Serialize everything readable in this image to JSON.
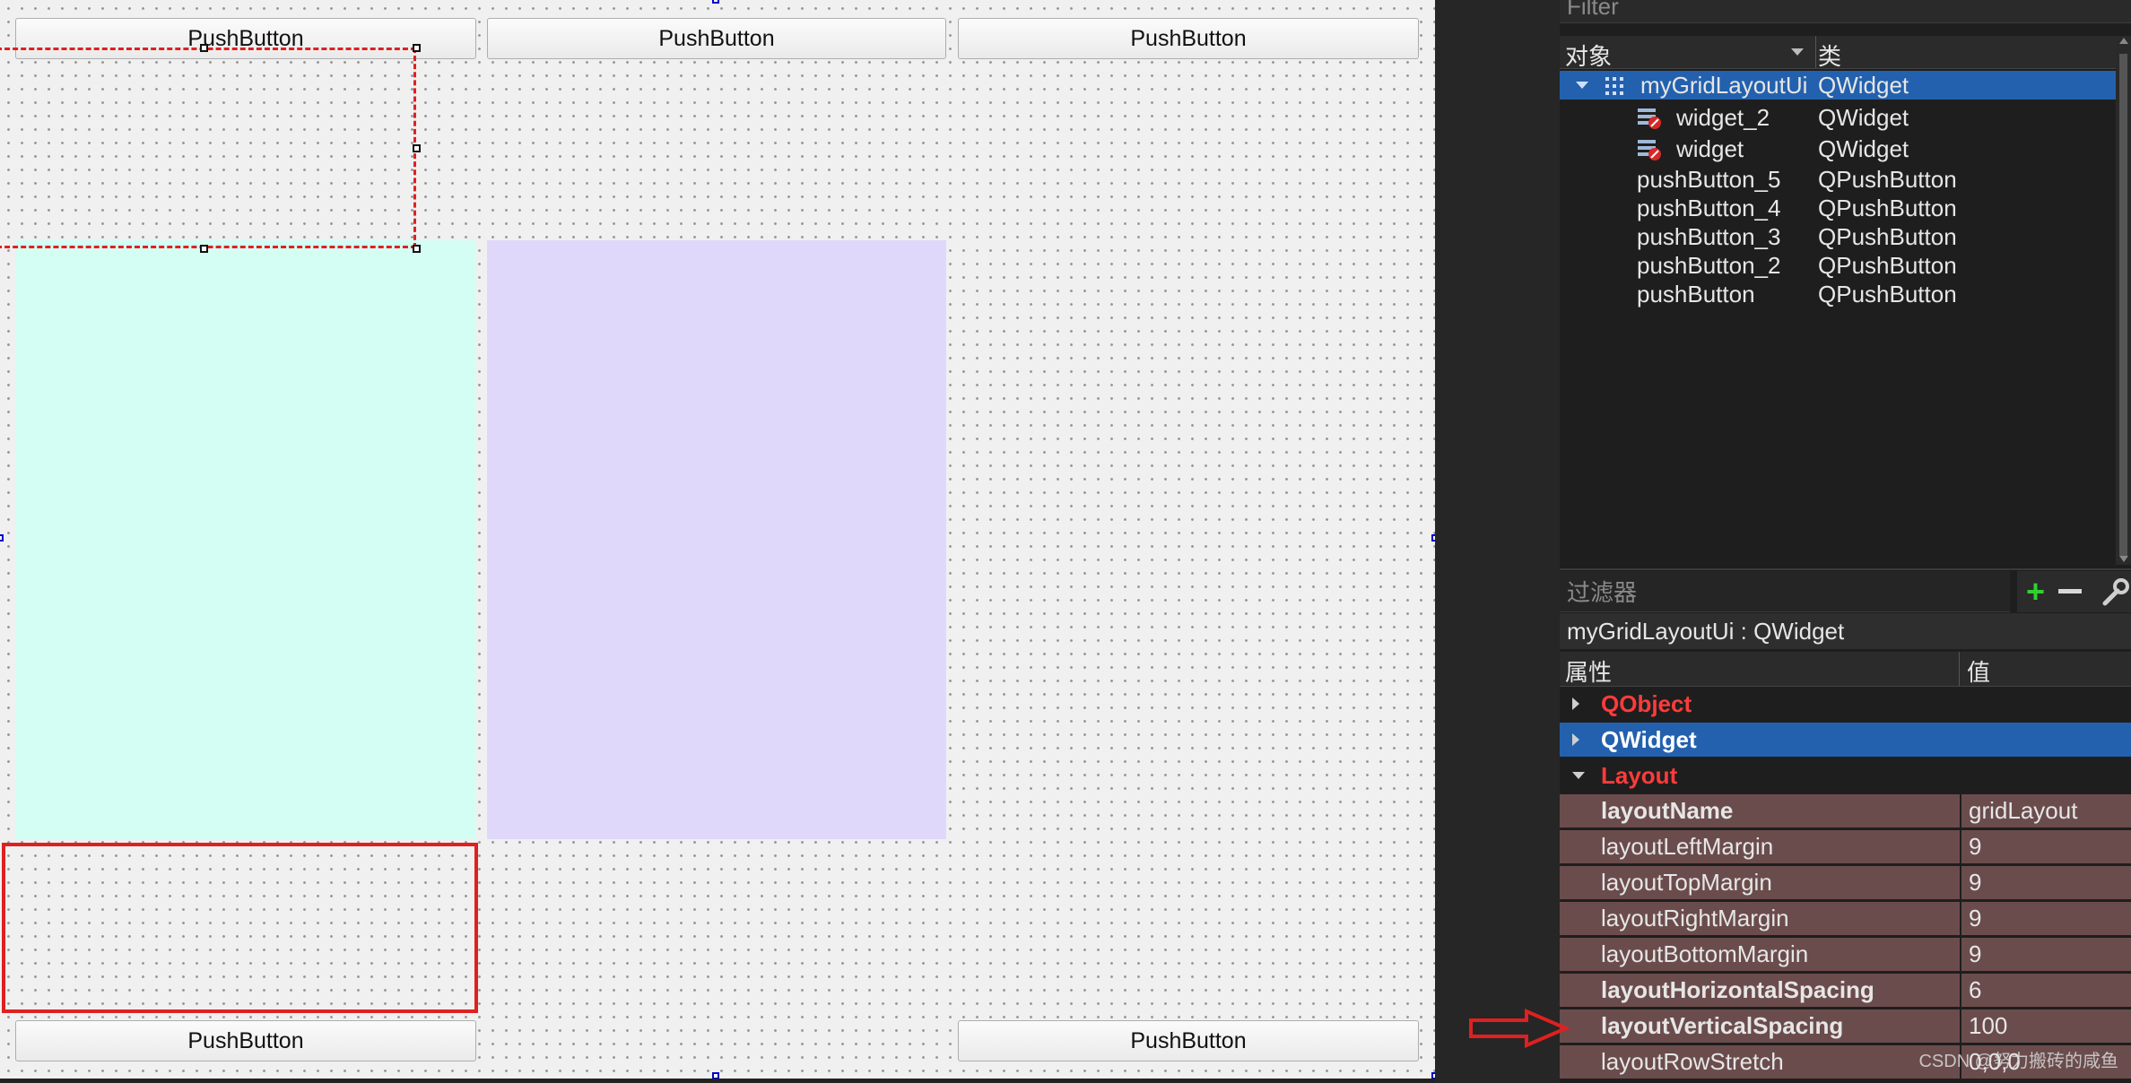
{
  "canvas": {
    "buttons": {
      "top_left": "PushButton",
      "top_middle": "PushButton",
      "top_right": "PushButton",
      "bottom_left": "PushButton",
      "bottom_right": "PushButton"
    },
    "colors": {
      "widget_2": "#d4fdf4",
      "widget": "#e0d8fb",
      "selection": "#e02020"
    }
  },
  "object_inspector": {
    "filter_placeholder": "Filter",
    "col_object": "对象",
    "col_class": "类",
    "objects": [
      {
        "name": "myGridLayoutUi",
        "class": "QWidget"
      },
      {
        "name": "widget_2",
        "class": "QWidget"
      },
      {
        "name": "widget",
        "class": "QWidget"
      },
      {
        "name": "pushButton_5",
        "class": "QPushButton"
      },
      {
        "name": "pushButton_4",
        "class": "QPushButton"
      },
      {
        "name": "pushButton_3",
        "class": "QPushButton"
      },
      {
        "name": "pushButton_2",
        "class": "QPushButton"
      },
      {
        "name": "pushButton",
        "class": "QPushButton"
      }
    ]
  },
  "property_editor": {
    "filter_placeholder": "过滤器",
    "object_title": "myGridLayoutUi : QWidget",
    "col_property": "属性",
    "col_value": "值",
    "groups": {
      "qobject": "QObject",
      "qwidget": "QWidget",
      "layout": "Layout"
    },
    "properties": [
      {
        "name": "layoutName",
        "value": "gridLayout"
      },
      {
        "name": "layoutLeftMargin",
        "value": "9"
      },
      {
        "name": "layoutTopMargin",
        "value": "9"
      },
      {
        "name": "layoutRightMargin",
        "value": "9"
      },
      {
        "name": "layoutBottomMargin",
        "value": "9"
      },
      {
        "name": "layoutHorizontalSpacing",
        "value": "6"
      },
      {
        "name": "layoutVerticalSpacing",
        "value": "100"
      },
      {
        "name": "layoutRowStretch",
        "value": "0,0,0"
      }
    ]
  },
  "watermark": "CSDN @努力搬砖的咸鱼",
  "colors": {
    "selection_blue": "#2361ae",
    "layout_row": "#6b4c4c",
    "group_red": "#ff3b3b",
    "arrow_red": "#e02020"
  }
}
